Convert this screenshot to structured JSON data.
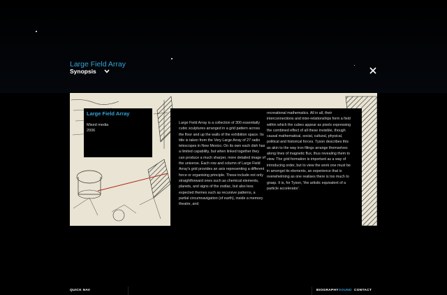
{
  "header": {
    "artwork_title": "Large Field Array",
    "section_label": "Synopsis"
  },
  "caption": {
    "title": "Large Field Array",
    "medium": "Mixed media",
    "year": "2006"
  },
  "synopsis": {
    "column1": "Large Field Array is a collection of 300 essentially cubic sculptures arranged in a grid pattern across the floor and up the walls of the exhibition space. Its title is taken from the Very Large Array of 27 radio telescopes in New Mexico. On its own each dish has a limited capability, but when linked together they can produce a much sharper, more detailed image of the universe. Each row and column of Large Field Array's grid provides an axis representing a different force or organising principle. These include not only straightforward ones such as chemical elements, planets, and signs of the zodiac, but also less expected themes such as recursive patterns, a partial circumnavigation (of earth), inside a memory theatre, and",
    "column2": "recreational mathematics. All in all, their interconnections and inter-relationships form a field within which the cubes appear as pixels expressing the combined effect of all these invisible, though causal mathematical, social, cultural, physical, political and historical forces. Tyson describes this as akin to the way iron filings arrange themselves along lines of magnetic flux, thus revealing them to view. The grid formation is important as a way of introducing order, but to view the work one must be in amongst its elements, an experience that is overwhelming as one realises there is too much to grasp. It is, for Tyson, 'the artistic equivalent of a particle accelerator'."
  },
  "footer": {
    "quick_nav": "QUICK NAV",
    "nav_items": [
      "BIOGRAPHY",
      "SOUND",
      "CONTACT"
    ],
    "active_item": "SOUND"
  },
  "colors": {
    "accent": "#35a3da",
    "background": "#000000",
    "nav_inactive": "#ffffff"
  },
  "icons": {
    "section_toggle": "chevron-down-icon",
    "close": "close-icon"
  }
}
